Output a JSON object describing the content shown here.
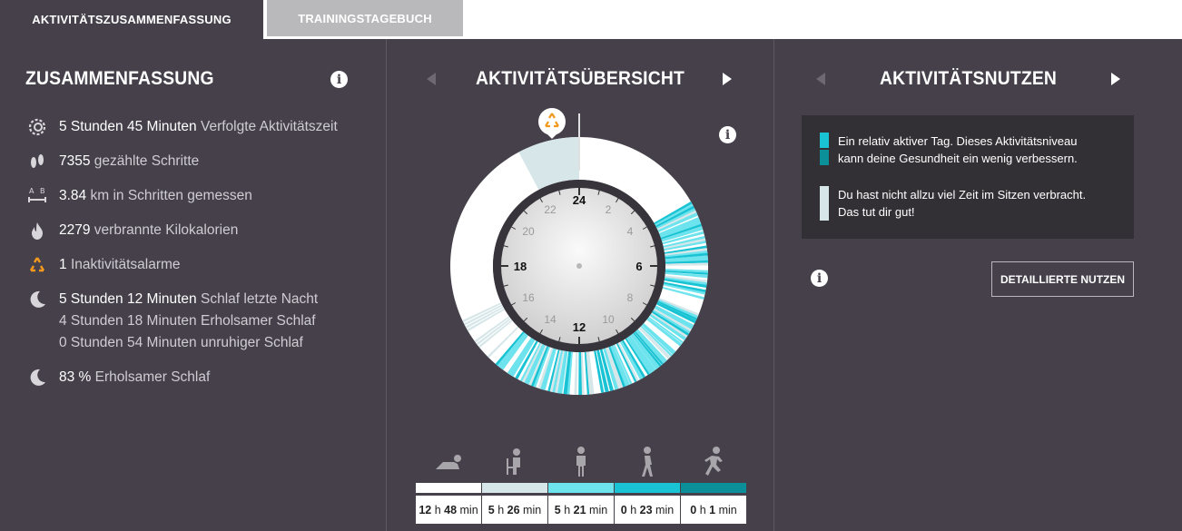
{
  "tabs": {
    "active": "AKTIVITÄTSZUSAMMENFASSUNG",
    "inactive": "TRAININGSTAGEBUCH"
  },
  "summary": {
    "title": "ZUSAMMENFASSUNG",
    "info_icon": "info-icon",
    "tracked_time": {
      "icon": "activity-ring-icon",
      "value": "5 Stunden 45 Minuten",
      "label": "Verfolgte Aktivitätszeit"
    },
    "steps": {
      "icon": "footprints-icon",
      "value": "7355",
      "label": "gezählte Schritte"
    },
    "distance": {
      "icon": "distance-ab-icon",
      "value": "3.84",
      "label": "km in Schritten gemessen"
    },
    "calories": {
      "icon": "flame-icon",
      "value": "2279",
      "label": "verbrannte Kilokalorien"
    },
    "inactivity": {
      "icon": "inactivity-alert-icon",
      "value": "1",
      "label": "Inaktivitätsalarme"
    },
    "sleep": {
      "icon": "moon-icon",
      "value": "5 Stunden 12 Minuten",
      "label": "Schlaf letzte Nacht",
      "restful": "4 Stunden 18 Minuten Erholsamer Schlaf",
      "restless": "0 Stunden 54 Minuten unruhiger Schlaf"
    },
    "sleep_quality": {
      "icon": "moon-icon",
      "value": "83 %",
      "label": "Erholsamer Schlaf"
    }
  },
  "overview": {
    "title": "AKTIVITÄTSÜBERSICHT",
    "clock_labels": {
      "h24": "24",
      "h2": "2",
      "h4": "4",
      "h6": "6",
      "h8": "8",
      "h10": "10",
      "h12": "12",
      "h14": "14",
      "h16": "16",
      "h18": "18",
      "h20": "20",
      "h22": "22"
    },
    "colors": {
      "lying": "#ffffff",
      "sitting": "#d7e7e9",
      "standing": "#6de3ee",
      "walking": "#19c3d3",
      "running": "#0b8f98"
    },
    "categories": [
      {
        "icon": "lying-down-icon",
        "value": "12 h 48 min",
        "h": "12",
        "m": "48"
      },
      {
        "icon": "sitting-icon",
        "value": "5 h 26 min",
        "h": "5",
        "m": "26"
      },
      {
        "icon": "standing-icon",
        "value": "5 h 21 min",
        "h": "5",
        "m": "21"
      },
      {
        "icon": "walking-icon",
        "value": "0 h 23 min",
        "h": "0",
        "m": "23"
      },
      {
        "icon": "running-icon",
        "value": "0 h 1 min",
        "h": "0",
        "m": "1"
      }
    ]
  },
  "benefit": {
    "title": "AKTIVITÄTSNUTZEN",
    "message1_line1": "Ein relativ aktiver Tag. Dieses Aktivitätsniveau",
    "message1_line2": "kann deine Gesundheit ein wenig verbessern.",
    "message2_line1": "Du hast nicht allzu viel Zeit im Sitzen verbracht.",
    "message2_line2": "Das tut dir gut!",
    "details_button": "DETAILLIERTE NUTZEN"
  }
}
